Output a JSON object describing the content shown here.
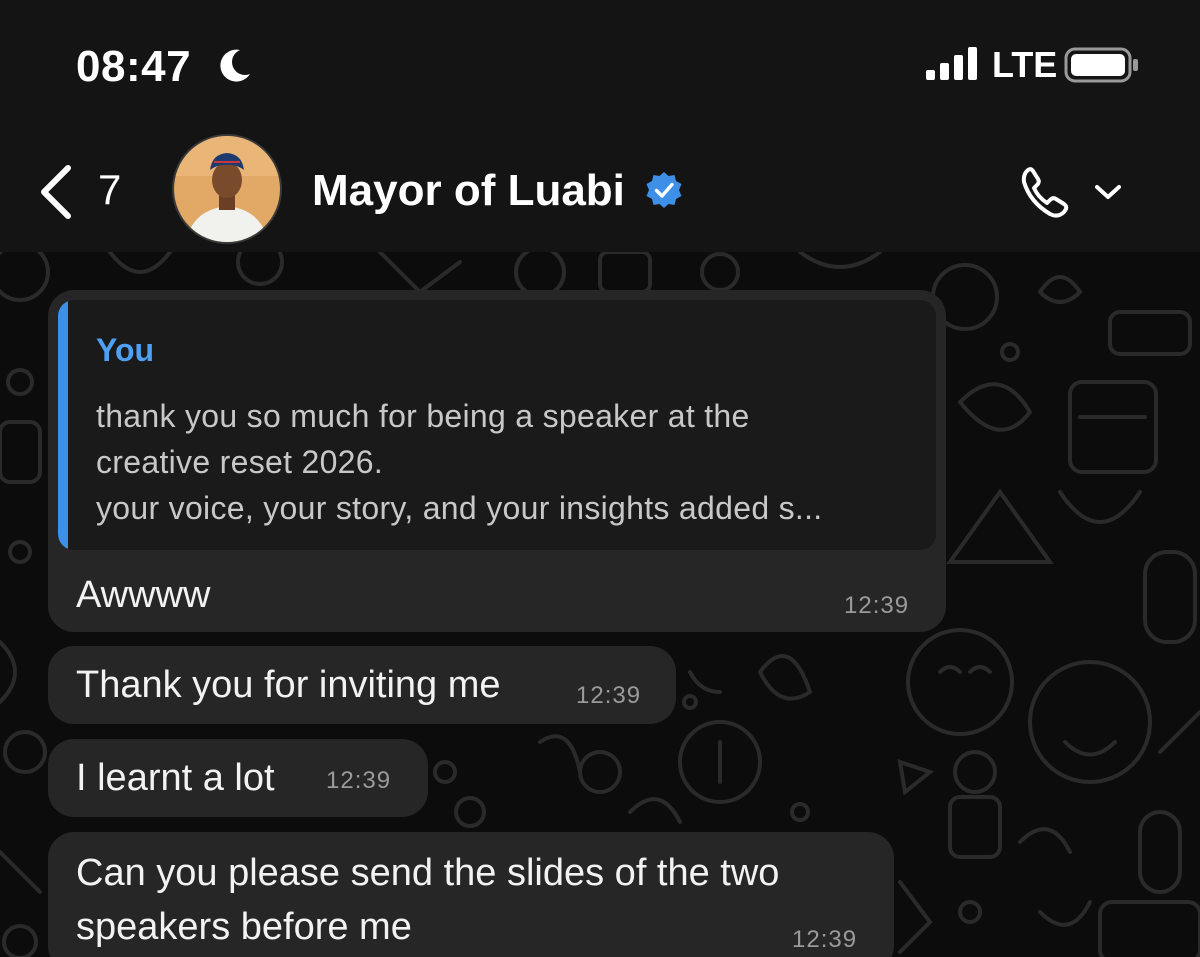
{
  "status_bar": {
    "time": "08:47",
    "network": "LTE",
    "icons": [
      "moon-icon",
      "signal-icon",
      "battery-icon"
    ]
  },
  "header": {
    "unread_count": "7",
    "contact_name": "Mayor of Luabi",
    "verified": true,
    "icons": [
      "chevron-left-icon",
      "verified-badge-icon",
      "phone-icon",
      "chevron-down-icon"
    ]
  },
  "colors": {
    "accent": "#3d8fe8",
    "bubble": "#262626",
    "quote_bg": "#1a1a1a",
    "background": "#0b0b0b"
  },
  "messages": [
    {
      "quote": {
        "sender": "You",
        "lines": [
          "thank you so much for being a speaker at the",
          "creative reset 2026.",
          "your voice, your story, and your insights added s..."
        ]
      },
      "text": "Awwww",
      "time": "12:39"
    },
    {
      "text": "Thank you for inviting me",
      "time": "12:39"
    },
    {
      "text": "I learnt a lot",
      "time": "12:39"
    },
    {
      "text_lines": [
        "Can you please send the slides of the two",
        "speakers before me"
      ],
      "time": "12:39"
    }
  ]
}
